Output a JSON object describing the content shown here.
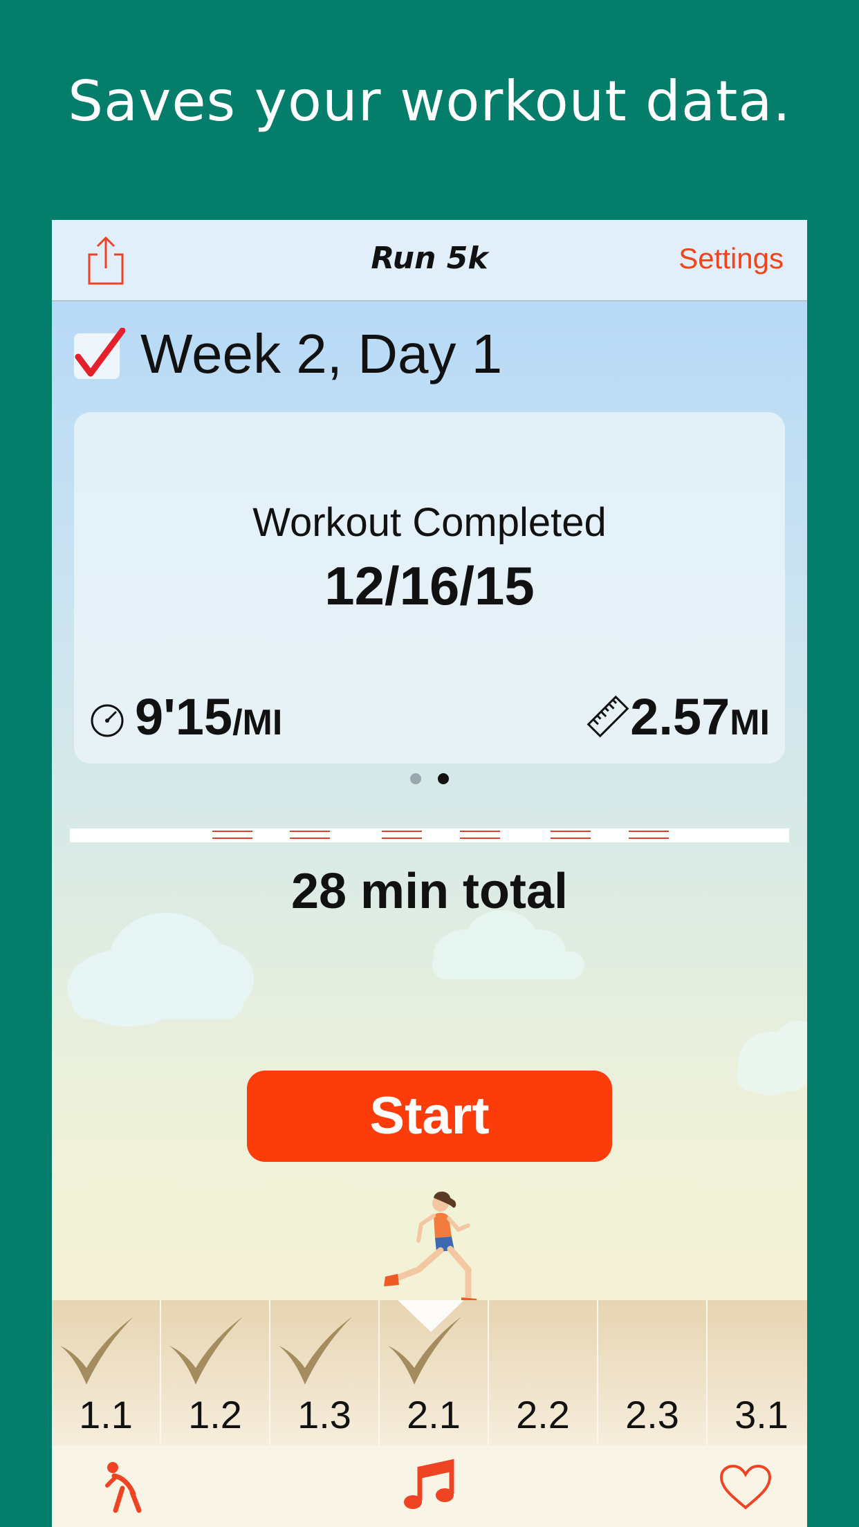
{
  "headline": "Saves your workout data.",
  "navbar": {
    "title": "Run 5k",
    "settings_label": "Settings",
    "share_icon": "share-icon"
  },
  "workout": {
    "day_title": "Week 2, Day 1",
    "completed": true,
    "card_label": "Workout Completed",
    "date": "12/16/15",
    "pace_value": "9'15",
    "pace_unit": "/MI",
    "distance_value": "2.57",
    "distance_unit": "MI",
    "page_count": 2,
    "active_page": 2
  },
  "total_label": "28 min total",
  "start_label": "Start",
  "days": [
    {
      "label": "1.1",
      "done": true
    },
    {
      "label": "1.2",
      "done": true
    },
    {
      "label": "1.3",
      "done": true
    },
    {
      "label": "2.1",
      "done": true,
      "selected": true
    },
    {
      "label": "2.2",
      "done": false
    },
    {
      "label": "2.3",
      "done": false
    },
    {
      "label": "3.1",
      "done": false
    }
  ],
  "tabbar": {
    "left_icon": "stretching-person-icon",
    "center_icon": "music-note-icon",
    "right_icon": "heart-icon"
  },
  "colors": {
    "background": "#047d6a",
    "accent": "#fc3c0a",
    "settings": "#f0451b",
    "checkmark": "#a48c5e"
  }
}
